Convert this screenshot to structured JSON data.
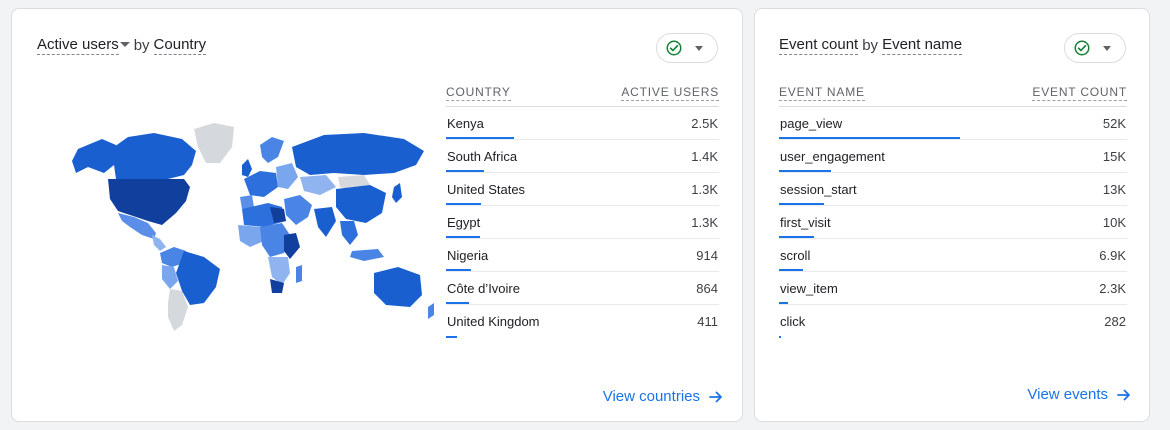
{
  "colors": {
    "accent": "#1a73e8",
    "success": "#188038"
  },
  "left_card": {
    "title_metric": "Active users",
    "title_by": "by",
    "title_dimension": "Country",
    "status_icon": "check-circle-icon",
    "table": {
      "col_dimension": "COUNTRY",
      "col_metric": "ACTIVE USERS",
      "rows": [
        {
          "label": "Kenya",
          "value": "2.5K",
          "fraction": 0.25
        },
        {
          "label": "South Africa",
          "value": "1.4K",
          "fraction": 0.14
        },
        {
          "label": "United States",
          "value": "1.3K",
          "fraction": 0.13
        },
        {
          "label": "Egypt",
          "value": "1.3K",
          "fraction": 0.125
        },
        {
          "label": "Nigeria",
          "value": "914",
          "fraction": 0.09
        },
        {
          "label": "Côte d’Ivoire",
          "value": "864",
          "fraction": 0.085
        },
        {
          "label": "United Kingdom",
          "value": "411",
          "fraction": 0.04
        }
      ]
    },
    "view_link": "View countries",
    "map_icon": "world-map"
  },
  "right_card": {
    "title_metric": "Event count",
    "title_by": "by",
    "title_dimension": "Event name",
    "status_icon": "check-circle-icon",
    "table": {
      "col_dimension": "EVENT NAME",
      "col_metric": "EVENT COUNT",
      "rows": [
        {
          "label": "page_view",
          "value": "52K",
          "fraction": 0.52
        },
        {
          "label": "user_engagement",
          "value": "15K",
          "fraction": 0.15
        },
        {
          "label": "session_start",
          "value": "13K",
          "fraction": 0.13
        },
        {
          "label": "first_visit",
          "value": "10K",
          "fraction": 0.1
        },
        {
          "label": "scroll",
          "value": "6.9K",
          "fraction": 0.07
        },
        {
          "label": "view_item",
          "value": "2.3K",
          "fraction": 0.025
        },
        {
          "label": "click",
          "value": "282",
          "fraction": 0.005
        }
      ]
    },
    "view_link": "View events"
  }
}
